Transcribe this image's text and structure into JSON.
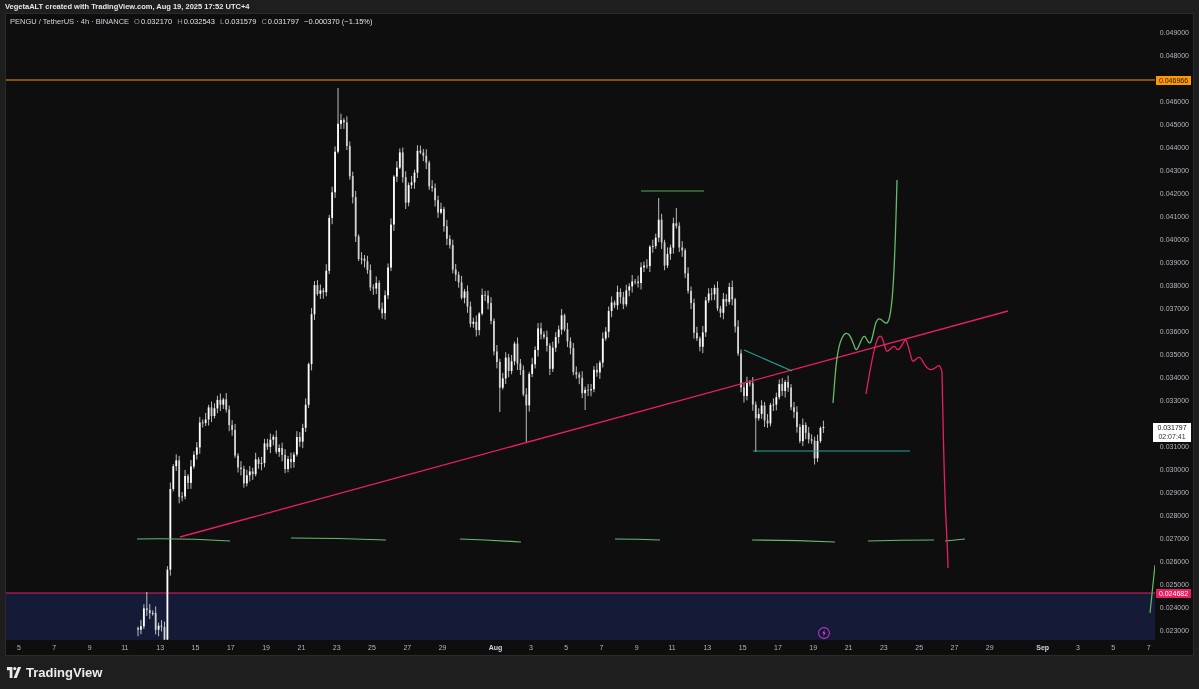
{
  "attribution": "VegetaALT created with TradingView.com, Aug 19, 2025 17:52 UTC+4",
  "legend": {
    "symbol": "PENGU / TetherUS · 4h · BINANCE",
    "ohlc": [
      {
        "key": "O",
        "value": "0.032170"
      },
      {
        "key": "H",
        "value": "0.032543"
      },
      {
        "key": "L",
        "value": "0.031579"
      },
      {
        "key": "C",
        "value": "0.031797"
      }
    ],
    "change": "−0.000370 (−1.15%)"
  },
  "price_scale": {
    "labels": [
      "0.049000",
      "0.048000",
      "0.046000",
      "0.045000",
      "0.044000",
      "0.043000",
      "0.042000",
      "0.041000",
      "0.040000",
      "0.039000",
      "0.038000",
      "0.037000",
      "0.036000",
      "0.035000",
      "0.034000",
      "0.033000",
      "0.031000",
      "0.030000",
      "0.029000",
      "0.028000",
      "0.027000",
      "0.026000",
      "0.025000",
      "0.024000",
      "0.023000"
    ]
  },
  "price_lines": [
    {
      "label": "0.046966",
      "color": "#ff9800"
    },
    {
      "label": "0.024682",
      "color": "#e91e63"
    }
  ],
  "last_price": {
    "price": "0.031797",
    "countdown": "02:07:41"
  },
  "time_scale": {
    "labels": [
      {
        "text": "5",
        "kind": "day"
      },
      {
        "text": "7",
        "kind": "day"
      },
      {
        "text": "9",
        "kind": "day"
      },
      {
        "text": "11",
        "kind": "day"
      },
      {
        "text": "13",
        "kind": "day"
      },
      {
        "text": "15",
        "kind": "day"
      },
      {
        "text": "17",
        "kind": "day"
      },
      {
        "text": "19",
        "kind": "day"
      },
      {
        "text": "21",
        "kind": "day"
      },
      {
        "text": "23",
        "kind": "day"
      },
      {
        "text": "25",
        "kind": "day"
      },
      {
        "text": "27",
        "kind": "day"
      },
      {
        "text": "29",
        "kind": "day"
      },
      {
        "text": "Aug",
        "kind": "month"
      },
      {
        "text": "3",
        "kind": "day"
      },
      {
        "text": "5",
        "kind": "day"
      },
      {
        "text": "7",
        "kind": "day"
      },
      {
        "text": "9",
        "kind": "day"
      },
      {
        "text": "11",
        "kind": "day"
      },
      {
        "text": "13",
        "kind": "day"
      },
      {
        "text": "15",
        "kind": "day"
      },
      {
        "text": "17",
        "kind": "day"
      },
      {
        "text": "19",
        "kind": "day"
      },
      {
        "text": "21",
        "kind": "day"
      },
      {
        "text": "23",
        "kind": "day"
      },
      {
        "text": "25",
        "kind": "day"
      },
      {
        "text": "27",
        "kind": "day"
      },
      {
        "text": "29",
        "kind": "day"
      },
      {
        "text": "Sep",
        "kind": "month"
      },
      {
        "text": "3",
        "kind": "day"
      },
      {
        "text": "5",
        "kind": "day"
      },
      {
        "text": "7",
        "kind": "day"
      }
    ]
  },
  "footer": {
    "brand": "TradingView"
  }
}
